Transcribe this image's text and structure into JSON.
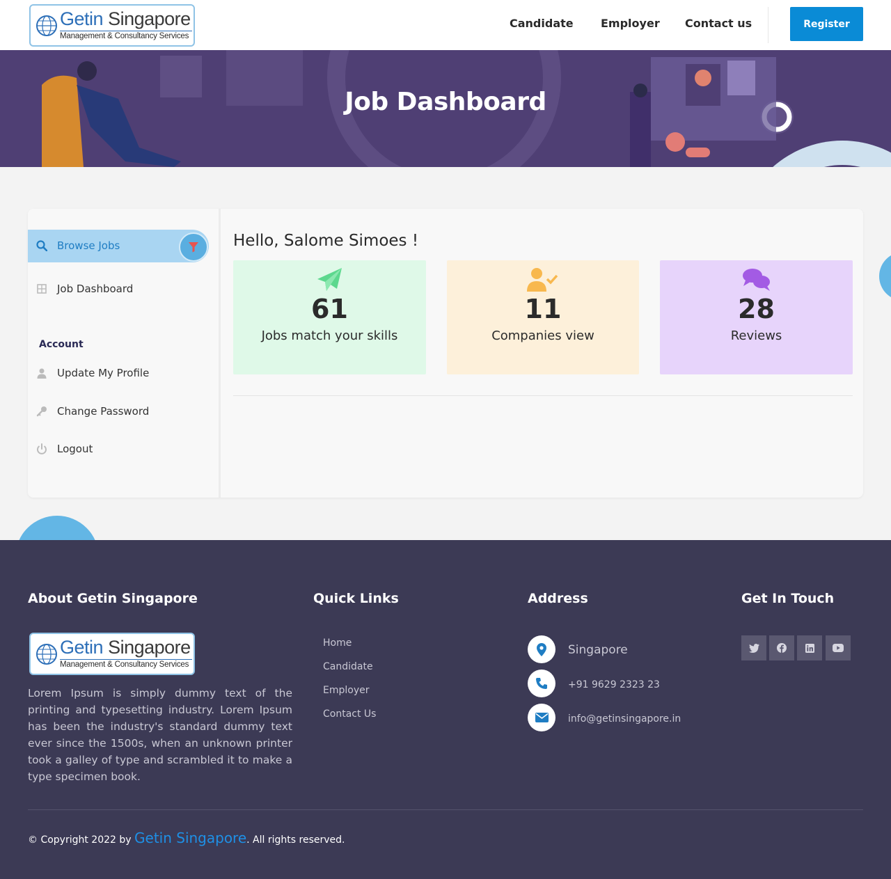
{
  "header": {
    "logo": {
      "word1": "Getin",
      "word2": "Singapore",
      "tagline": "Management & Consultancy Services"
    },
    "nav": [
      "Candidate",
      "Employer",
      "Contact us"
    ],
    "register_label": "Register"
  },
  "hero": {
    "title": "Job Dashboard"
  },
  "sidebar": {
    "browse_jobs": "Browse Jobs",
    "job_dashboard": "Job Dashboard",
    "account_heading": "Account",
    "update_profile": "Update My Profile",
    "change_password": "Change Password",
    "logout": "Logout"
  },
  "dashboard": {
    "greeting": "Hello, Salome Simoes !",
    "stats": [
      {
        "value": "61",
        "label": "Jobs match your skills",
        "icon": "paper-plane-icon",
        "bg": "#dff9e8",
        "icon_color": "#5dd88e"
      },
      {
        "value": "11",
        "label": "Companies view",
        "icon": "user-check-icon",
        "bg": "#fdf0da",
        "icon_color": "#f8b84e"
      },
      {
        "value": "28",
        "label": "Reviews",
        "icon": "comments-icon",
        "bg": "#e7d4fb",
        "icon_color": "#a35be4"
      }
    ]
  },
  "footer": {
    "about_heading": "About Getin Singapore",
    "about_text": "Lorem Ipsum is simply dummy text of the printing and typesetting industry. Lorem Ipsum has been the industry's standard dummy text ever since the 1500s, when an unknown printer took a galley of type and scrambled it to make a type specimen book.",
    "quick_links_heading": "Quick Links",
    "quick_links": [
      "Home",
      "Candidate",
      "Employer",
      "Contact Us"
    ],
    "address_heading": "Address",
    "address": {
      "location": "Singapore",
      "phone": "+91 9629 2323 23",
      "email": "info@getinsingapore.in"
    },
    "touch_heading": "Get In Touch",
    "social": [
      "twitter-icon",
      "facebook-icon",
      "linkedin-icon",
      "youtube-icon"
    ],
    "copyright_pre": "© Copyright 2022 by ",
    "copyright_brand": "Getin Singapore",
    "copyright_post": ". All rights reserved."
  },
  "colors": {
    "accent": "#0a8bd6",
    "hero_bg": "#4f3f74",
    "footer_bg": "#3c3a55"
  }
}
